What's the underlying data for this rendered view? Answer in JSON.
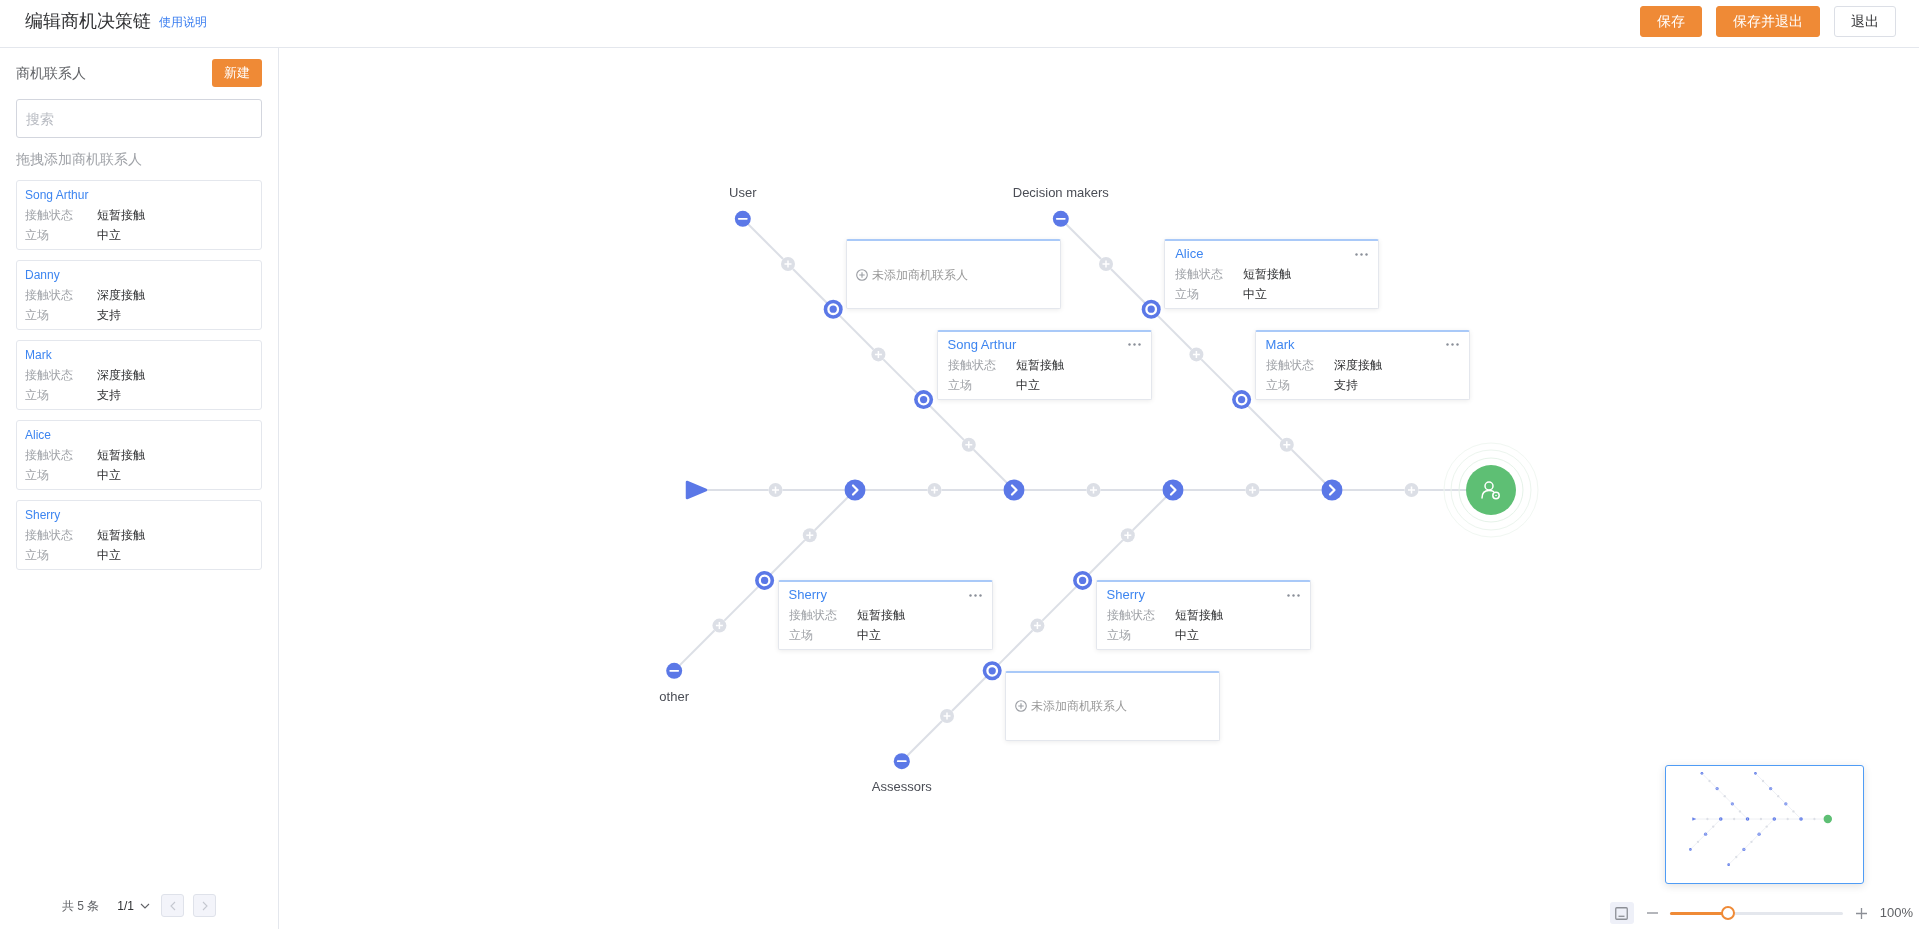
{
  "header": {
    "title": "编辑商机决策链",
    "help_link": "使用说明",
    "buttons": [
      {
        "label": "保存",
        "kind": "primary"
      },
      {
        "label": "保存并退出",
        "kind": "primary"
      },
      {
        "label": "退出",
        "kind": "default"
      }
    ]
  },
  "sidebar": {
    "title": "商机联系人",
    "new_button": "新建",
    "search": {
      "placeholder": "搜索"
    },
    "hint": "拖拽添加商机联系人",
    "contacts": [
      {
        "name": "Song Arthur",
        "fields": [
          {
            "label": "接触状态",
            "value": "短暂接触"
          },
          {
            "label": "立场",
            "value": "中立"
          }
        ]
      },
      {
        "name": "Danny",
        "fields": [
          {
            "label": "接触状态",
            "value": "深度接触"
          },
          {
            "label": "立场",
            "value": "支持"
          }
        ]
      },
      {
        "name": "Mark",
        "fields": [
          {
            "label": "接触状态",
            "value": "深度接触"
          },
          {
            "label": "立场",
            "value": "支持"
          }
        ]
      },
      {
        "name": "Alice",
        "fields": [
          {
            "label": "接触状态",
            "value": "短暂接触"
          },
          {
            "label": "立场",
            "value": "中立"
          }
        ]
      },
      {
        "name": "Sherry",
        "fields": [
          {
            "label": "接触状态",
            "value": "短暂接触"
          },
          {
            "label": "立场",
            "value": "中立"
          }
        ]
      }
    ],
    "pagination": {
      "total": "共 5 条",
      "page": "1/1",
      "prev_disabled": true,
      "next_disabled": true
    }
  },
  "chain": {
    "branches": [
      {
        "label": "other",
        "kind": "lower",
        "slots": [
          {
            "kind": "contact",
            "name": "Sherry",
            "fields": [
              {
                "label": "接触状态",
                "value": "短暂接触"
              },
              {
                "label": "立场",
                "value": "中立"
              }
            ]
          }
        ]
      },
      {
        "label": "User",
        "kind": "upper",
        "slots": [
          {
            "kind": "empty",
            "text": "未添加商机联系人"
          },
          {
            "kind": "contact",
            "name": "Song Arthur",
            "fields": [
              {
                "label": "接触状态",
                "value": "短暂接触"
              },
              {
                "label": "立场",
                "value": "中立"
              }
            ]
          }
        ]
      },
      {
        "label": "Assessors",
        "kind": "lower",
        "slots": [
          {
            "kind": "contact",
            "name": "Sherry",
            "fields": [
              {
                "label": "接触状态",
                "value": "短暂接触"
              },
              {
                "label": "立场",
                "value": "中立"
              }
            ]
          },
          {
            "kind": "empty",
            "text": "未添加商机联系人"
          }
        ]
      },
      {
        "label": "Decision makers",
        "kind": "upper",
        "slots": [
          {
            "kind": "contact",
            "name": "Alice",
            "fields": [
              {
                "label": "接触状态",
                "value": "短暂接触"
              },
              {
                "label": "立场",
                "value": "中立"
              }
            ]
          },
          {
            "kind": "contact",
            "name": "Mark",
            "fields": [
              {
                "label": "接触状态",
                "value": "深度接触"
              },
              {
                "label": "立场",
                "value": "支持"
              }
            ]
          }
        ]
      }
    ]
  },
  "zoom": {
    "level": 0.335,
    "reading": "100%"
  }
}
